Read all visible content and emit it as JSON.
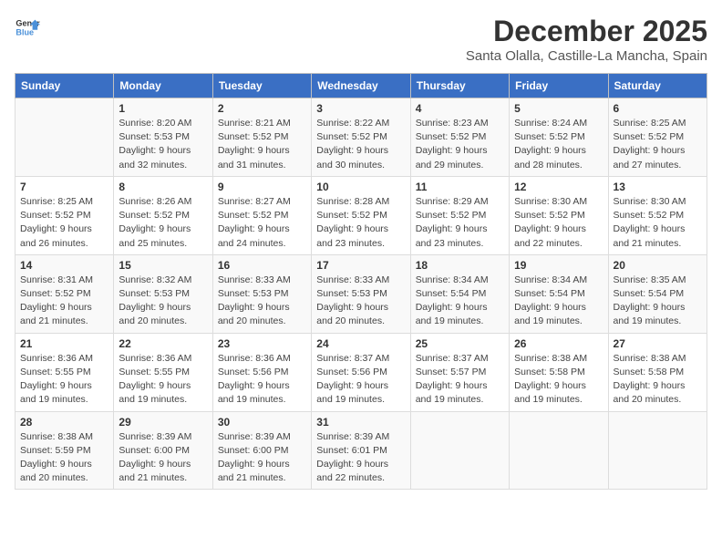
{
  "header": {
    "logo_line1": "General",
    "logo_line2": "Blue",
    "title": "December 2025",
    "subtitle": "Santa Olalla, Castille-La Mancha, Spain"
  },
  "days_of_week": [
    "Sunday",
    "Monday",
    "Tuesday",
    "Wednesday",
    "Thursday",
    "Friday",
    "Saturday"
  ],
  "weeks": [
    [
      {
        "day": "",
        "info": ""
      },
      {
        "day": "1",
        "info": "Sunrise: 8:20 AM\nSunset: 5:53 PM\nDaylight: 9 hours\nand 32 minutes."
      },
      {
        "day": "2",
        "info": "Sunrise: 8:21 AM\nSunset: 5:52 PM\nDaylight: 9 hours\nand 31 minutes."
      },
      {
        "day": "3",
        "info": "Sunrise: 8:22 AM\nSunset: 5:52 PM\nDaylight: 9 hours\nand 30 minutes."
      },
      {
        "day": "4",
        "info": "Sunrise: 8:23 AM\nSunset: 5:52 PM\nDaylight: 9 hours\nand 29 minutes."
      },
      {
        "day": "5",
        "info": "Sunrise: 8:24 AM\nSunset: 5:52 PM\nDaylight: 9 hours\nand 28 minutes."
      },
      {
        "day": "6",
        "info": "Sunrise: 8:25 AM\nSunset: 5:52 PM\nDaylight: 9 hours\nand 27 minutes."
      }
    ],
    [
      {
        "day": "7",
        "info": "Sunrise: 8:25 AM\nSunset: 5:52 PM\nDaylight: 9 hours\nand 26 minutes."
      },
      {
        "day": "8",
        "info": "Sunrise: 8:26 AM\nSunset: 5:52 PM\nDaylight: 9 hours\nand 25 minutes."
      },
      {
        "day": "9",
        "info": "Sunrise: 8:27 AM\nSunset: 5:52 PM\nDaylight: 9 hours\nand 24 minutes."
      },
      {
        "day": "10",
        "info": "Sunrise: 8:28 AM\nSunset: 5:52 PM\nDaylight: 9 hours\nand 23 minutes."
      },
      {
        "day": "11",
        "info": "Sunrise: 8:29 AM\nSunset: 5:52 PM\nDaylight: 9 hours\nand 23 minutes."
      },
      {
        "day": "12",
        "info": "Sunrise: 8:30 AM\nSunset: 5:52 PM\nDaylight: 9 hours\nand 22 minutes."
      },
      {
        "day": "13",
        "info": "Sunrise: 8:30 AM\nSunset: 5:52 PM\nDaylight: 9 hours\nand 21 minutes."
      }
    ],
    [
      {
        "day": "14",
        "info": "Sunrise: 8:31 AM\nSunset: 5:52 PM\nDaylight: 9 hours\nand 21 minutes."
      },
      {
        "day": "15",
        "info": "Sunrise: 8:32 AM\nSunset: 5:53 PM\nDaylight: 9 hours\nand 20 minutes."
      },
      {
        "day": "16",
        "info": "Sunrise: 8:33 AM\nSunset: 5:53 PM\nDaylight: 9 hours\nand 20 minutes."
      },
      {
        "day": "17",
        "info": "Sunrise: 8:33 AM\nSunset: 5:53 PM\nDaylight: 9 hours\nand 20 minutes."
      },
      {
        "day": "18",
        "info": "Sunrise: 8:34 AM\nSunset: 5:54 PM\nDaylight: 9 hours\nand 19 minutes."
      },
      {
        "day": "19",
        "info": "Sunrise: 8:34 AM\nSunset: 5:54 PM\nDaylight: 9 hours\nand 19 minutes."
      },
      {
        "day": "20",
        "info": "Sunrise: 8:35 AM\nSunset: 5:54 PM\nDaylight: 9 hours\nand 19 minutes."
      }
    ],
    [
      {
        "day": "21",
        "info": "Sunrise: 8:36 AM\nSunset: 5:55 PM\nDaylight: 9 hours\nand 19 minutes."
      },
      {
        "day": "22",
        "info": "Sunrise: 8:36 AM\nSunset: 5:55 PM\nDaylight: 9 hours\nand 19 minutes."
      },
      {
        "day": "23",
        "info": "Sunrise: 8:36 AM\nSunset: 5:56 PM\nDaylight: 9 hours\nand 19 minutes."
      },
      {
        "day": "24",
        "info": "Sunrise: 8:37 AM\nSunset: 5:56 PM\nDaylight: 9 hours\nand 19 minutes."
      },
      {
        "day": "25",
        "info": "Sunrise: 8:37 AM\nSunset: 5:57 PM\nDaylight: 9 hours\nand 19 minutes."
      },
      {
        "day": "26",
        "info": "Sunrise: 8:38 AM\nSunset: 5:58 PM\nDaylight: 9 hours\nand 19 minutes."
      },
      {
        "day": "27",
        "info": "Sunrise: 8:38 AM\nSunset: 5:58 PM\nDaylight: 9 hours\nand 20 minutes."
      }
    ],
    [
      {
        "day": "28",
        "info": "Sunrise: 8:38 AM\nSunset: 5:59 PM\nDaylight: 9 hours\nand 20 minutes."
      },
      {
        "day": "29",
        "info": "Sunrise: 8:39 AM\nSunset: 6:00 PM\nDaylight: 9 hours\nand 21 minutes."
      },
      {
        "day": "30",
        "info": "Sunrise: 8:39 AM\nSunset: 6:00 PM\nDaylight: 9 hours\nand 21 minutes."
      },
      {
        "day": "31",
        "info": "Sunrise: 8:39 AM\nSunset: 6:01 PM\nDaylight: 9 hours\nand 22 minutes."
      },
      {
        "day": "",
        "info": ""
      },
      {
        "day": "",
        "info": ""
      },
      {
        "day": "",
        "info": ""
      }
    ]
  ]
}
